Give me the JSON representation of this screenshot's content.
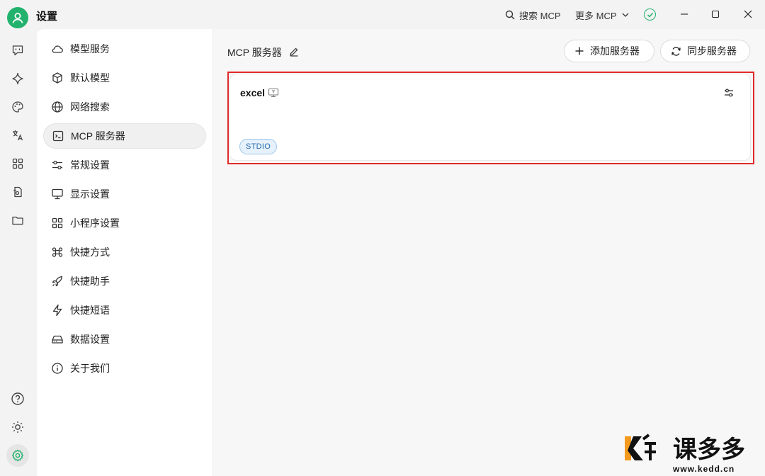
{
  "window": {
    "title": "设置"
  },
  "titlebar": {
    "search_label": "搜索 MCP",
    "more_label": "更多 MCP"
  },
  "rail": {
    "icons": [
      "chat-icon",
      "sparkle-icon",
      "palette-icon",
      "translate-icon",
      "apps-icon",
      "file-doc-icon",
      "folder-icon",
      "help-icon",
      "theme-icon",
      "settings-icon"
    ]
  },
  "nav": {
    "items": [
      {
        "label": "模型服务",
        "icon": "cloud-icon"
      },
      {
        "label": "默认模型",
        "icon": "cube-icon"
      },
      {
        "label": "网络搜索",
        "icon": "globe-icon"
      },
      {
        "label": "MCP 服务器",
        "icon": "terminal-icon"
      },
      {
        "label": "常规设置",
        "icon": "sliders-icon"
      },
      {
        "label": "显示设置",
        "icon": "monitor-icon"
      },
      {
        "label": "小程序设置",
        "icon": "grid-icon"
      },
      {
        "label": "快捷方式",
        "icon": "command-icon"
      },
      {
        "label": "快捷助手",
        "icon": "rocket-icon"
      },
      {
        "label": "快捷短语",
        "icon": "bolt-icon"
      },
      {
        "label": "数据设置",
        "icon": "drive-icon"
      },
      {
        "label": "关于我们",
        "icon": "info-icon"
      }
    ],
    "active_index": 3
  },
  "main": {
    "title": "MCP 服务器",
    "add_button": "添加服务器",
    "sync_button": "同步服务器",
    "servers": [
      {
        "name": "excel",
        "type_badge": "STDIO"
      }
    ]
  },
  "watermark": {
    "brand": "课多多",
    "url": "www.kedd.cn"
  },
  "colors": {
    "accent": "#23b26d",
    "highlight": "#e12a2a",
    "badge_bg": "#e6f1fb",
    "badge_text": "#2b6cb0"
  }
}
